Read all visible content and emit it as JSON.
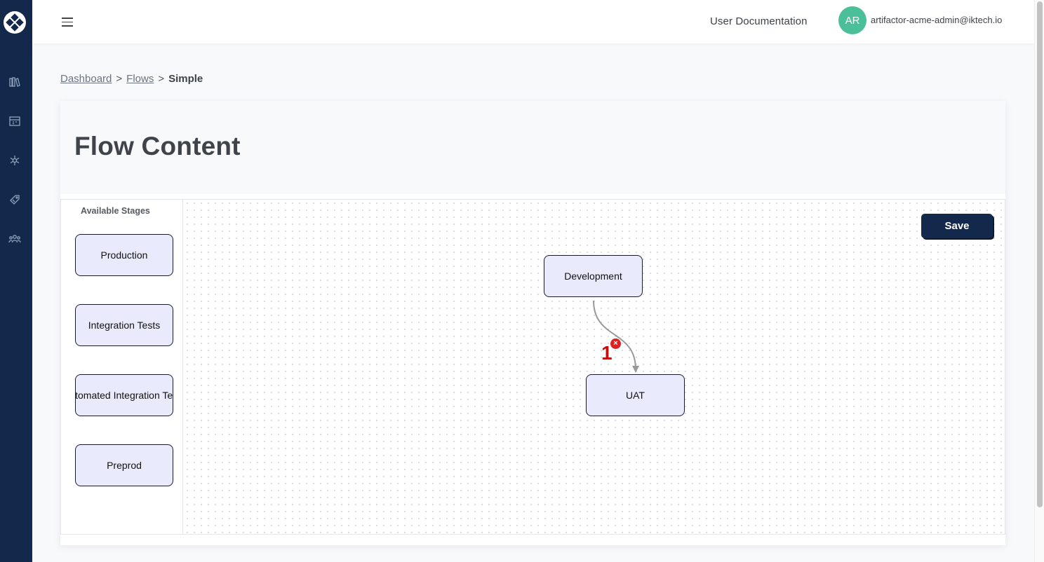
{
  "topbar": {
    "docs_label": "User Documentation",
    "avatar_initials": "AR",
    "user_email": "artifactor-acme-admin@iktech.io"
  },
  "sidebar": {
    "icons": [
      "library-icon",
      "calendar-icon",
      "network-icon",
      "tag-icon",
      "team-icon"
    ]
  },
  "breadcrumb": {
    "items": [
      "Dashboard",
      "Flows"
    ],
    "current": "Simple",
    "separator": ">"
  },
  "page": {
    "title": "Flow Content"
  },
  "stages_panel": {
    "title": "Available Stages",
    "stages": [
      "Production",
      "Integration Tests",
      "Automated Integration Tests",
      "Preprod"
    ]
  },
  "canvas": {
    "save_label": "Save",
    "nodes": [
      "Development",
      "UAT"
    ],
    "edge": {
      "from": "Development",
      "to": "UAT",
      "label": "1",
      "delete_glyph": "×"
    }
  },
  "colors": {
    "sidebar": "#13294b",
    "avatar": "#4bbf9a",
    "node_fill": "#e9ebfc",
    "edge_label": "#c40f0f",
    "delete": "#e02020"
  }
}
